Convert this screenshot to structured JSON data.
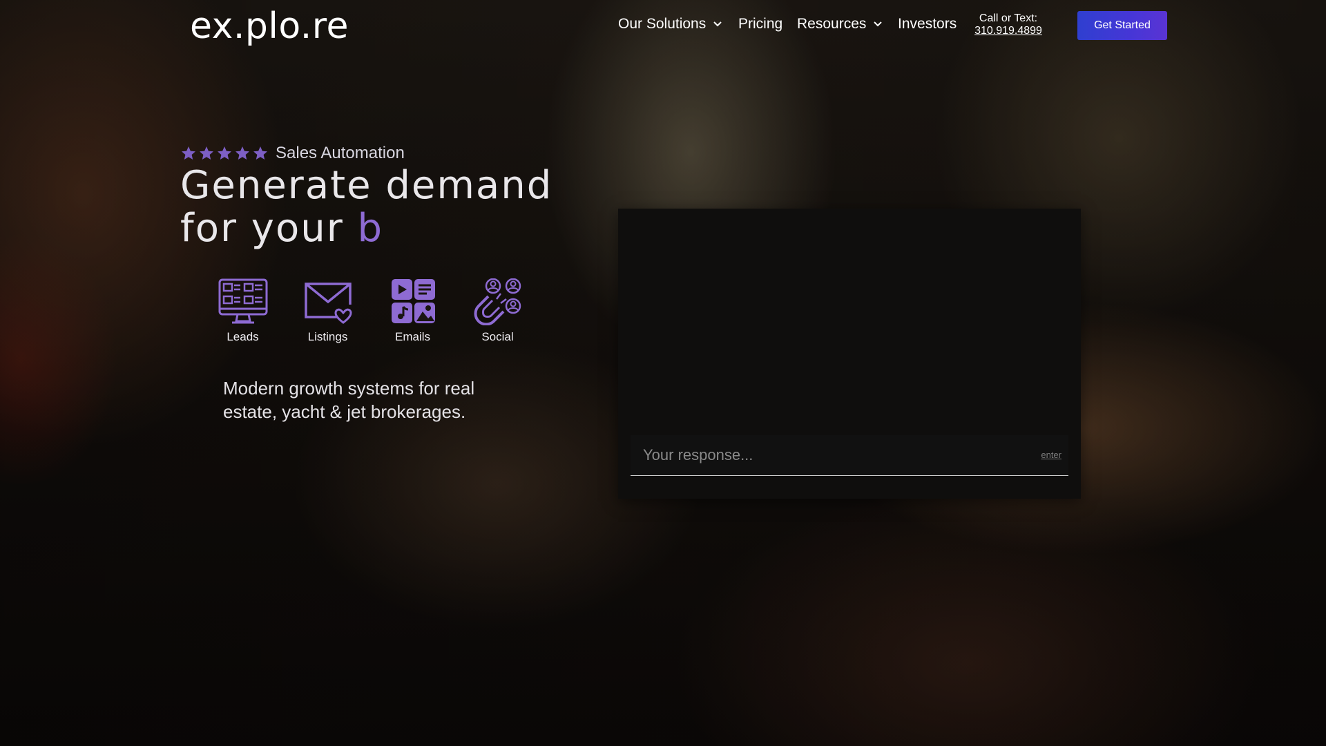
{
  "nav": {
    "logo": "ex.plo.re",
    "items": [
      {
        "label": "Our Solutions",
        "has_dropdown": true
      },
      {
        "label": "Pricing",
        "has_dropdown": false
      },
      {
        "label": "Resources",
        "has_dropdown": true
      },
      {
        "label": "Investors",
        "has_dropdown": false
      }
    ],
    "call_label": "Call or Text:",
    "phone": "310.919.4899",
    "cta_label": "Get Started"
  },
  "hero": {
    "rating_stars": 5,
    "rating_label": "Sales Automation",
    "headline_line1": "Generate demand",
    "headline_line2": "for your ",
    "headline_accent": "b",
    "features": [
      {
        "label": "Leads",
        "icon": "monitor-grid-icon"
      },
      {
        "label": "Listings",
        "icon": "envelope-heart-icon"
      },
      {
        "label": "Emails",
        "icon": "media-tiles-icon"
      },
      {
        "label": "Social",
        "icon": "magnet-users-icon"
      }
    ],
    "tagline": "Modern growth systems for real estate, yacht & jet brokerages."
  },
  "chat": {
    "placeholder": "Your response...",
    "enter_hint": "enter"
  },
  "colors": {
    "accent": "#8e6bd3",
    "cta_start": "#2f3fd0",
    "cta_end": "#5a34d4",
    "panel_bg": "#0f0e0d"
  }
}
